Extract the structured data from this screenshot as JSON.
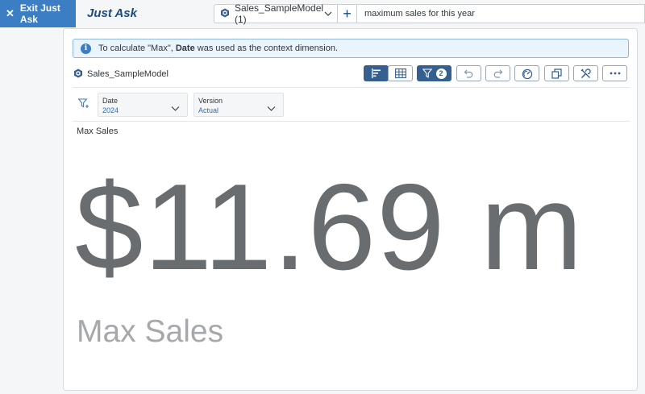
{
  "topbar": {
    "exit_label": "Exit Just Ask",
    "title": "Just Ask",
    "model_name": "Sales_SampleModel (1)",
    "query": "maximum sales for this year"
  },
  "banner": {
    "prefix": "To calculate \"Max\", ",
    "bold": "Date",
    "suffix": " was used as the context dimension."
  },
  "model": {
    "name": "Sales_SampleModel"
  },
  "toolbar": {
    "filter_count": "2"
  },
  "filters": [
    {
      "label": "Date",
      "value": "2024"
    },
    {
      "label": "Version",
      "value": "Actual"
    }
  ],
  "kpi": {
    "title": "Max Sales",
    "value": "$11.69 m",
    "label": "Max Sales"
  },
  "colors": {
    "accent": "#3b7ec4",
    "active_button": "#355f8f",
    "kpi_text": "#6a6d70"
  }
}
